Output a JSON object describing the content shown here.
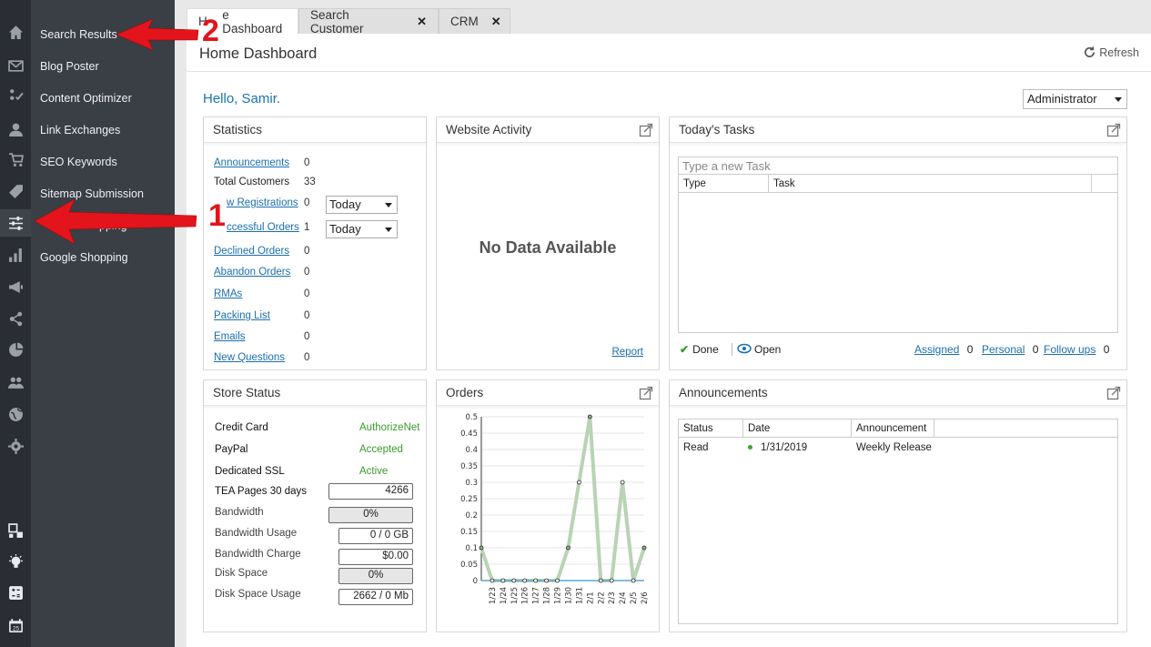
{
  "sidebar": {
    "rail_icons": [
      "home-icon",
      "mail-icon",
      "checklist-icon",
      "user-icon",
      "cart-icon",
      "tag-icon",
      "sliders-icon",
      "bar-chart-icon",
      "megaphone-icon",
      "share-icon",
      "pie-chart-icon",
      "users-group-icon",
      "globe-icon",
      "gear-icon",
      "layout-icon",
      "lightbulb-icon",
      "calculator-icon",
      "calendar-icon"
    ],
    "menu_items": [
      "Search Results",
      "Blog Poster",
      "Content Optimizer",
      "Link Exchanges",
      "SEO Keywords",
      "Sitemap Submission",
      "pping",
      "Google Shopping"
    ]
  },
  "tabs": [
    {
      "label": "H",
      "label2": "e Dashboard"
    },
    {
      "label": "Search Customer",
      "close": "✕"
    },
    {
      "label": "CRM",
      "close": "✕"
    }
  ],
  "header": {
    "title": "Home Dashboard",
    "refresh_label": "Refresh"
  },
  "greeting": "Hello, Samir.",
  "role": "Administrator",
  "statistics": {
    "title": "Statistics",
    "rows": [
      {
        "label": "Announcements",
        "value": "0",
        "link": true
      },
      {
        "label": "Total Customers",
        "value": "33",
        "link": false
      },
      {
        "label": "w Registrations",
        "value": "0",
        "link": true,
        "period": "Today"
      },
      {
        "label": "ccessful Orders",
        "value": "1",
        "link": true,
        "period": "Today"
      },
      {
        "label": "Declined Orders",
        "value": "0",
        "link": true
      },
      {
        "label": "Abandon Orders",
        "value": "0",
        "link": true
      },
      {
        "label": "RMAs",
        "value": "0",
        "link": true
      },
      {
        "label": "Packing List",
        "value": "0",
        "link": true
      },
      {
        "label": "Emails",
        "value": "0",
        "link": true
      },
      {
        "label": "New Questions",
        "value": "0",
        "link": true
      }
    ]
  },
  "website_activity": {
    "title": "Website Activity",
    "empty": "No Data Available",
    "report": "Report"
  },
  "tasks": {
    "title": "Today's Tasks",
    "placeholder": "Type a new Task",
    "columns": [
      "Type",
      "Task"
    ],
    "done": "Done",
    "open": "Open",
    "assigned": "Assigned",
    "assigned_count": "0",
    "personal": "Personal",
    "personal_count": "0",
    "followups": "Follow ups",
    "followups_count": "0"
  },
  "store_status": {
    "title": "Store Status",
    "credit_card": "Credit Card",
    "credit_card_value": "AuthorizeNet",
    "paypal": "PayPal",
    "paypal_value": "Accepted",
    "ssl": "Dedicated SSL",
    "ssl_value": "Active",
    "tea_pages": "TEA Pages 30 days",
    "tea_pages_value": "4266",
    "bandwidth": "Bandwidth",
    "bandwidth_value": "0%",
    "bandwidth_usage": "Bandwidth Usage",
    "bandwidth_usage_value": "0 / 0 GB",
    "bandwidth_charge": "Bandwidth Charge",
    "bandwidth_charge_value": "$0.00",
    "disk_space": "Disk Space",
    "disk_space_value": "0%",
    "disk_usage": "Disk Space Usage",
    "disk_usage_value": "2662 / 0 Mb"
  },
  "orders": {
    "title": "Orders"
  },
  "announcements": {
    "title": "Announcements",
    "columns": [
      "Status",
      "Date",
      "Announcement"
    ],
    "rows": [
      {
        "status": "Read",
        "date": "1/31/2019",
        "text": "Weekly Release"
      }
    ]
  },
  "annotations": {
    "callout_1": "1",
    "callout_2": "2"
  },
  "colors": {
    "link": "#1a6fb0",
    "accent_green": "#3a9a2a",
    "callout": "#e3141b",
    "series": "#b9d3b5"
  },
  "chart_data": {
    "type": "line",
    "title": "",
    "categories": [
      "1/23",
      "1/24",
      "1/25",
      "1/26",
      "1/27",
      "1/28",
      "1/29",
      "1/30",
      "1/31",
      "2/1",
      "2/2",
      "2/3",
      "2/4",
      "2/5",
      "2/6"
    ],
    "series": [
      {
        "values": [
          0.1,
          0,
          0,
          0,
          0,
          0,
          0,
          0,
          0.1,
          0.3,
          0.5,
          0,
          0,
          0.3,
          0,
          0.1
        ]
      }
    ],
    "x_points": [
      "1/23",
      "1/23b",
      "1/24",
      "1/25",
      "1/26",
      "1/27",
      "1/28",
      "1/29",
      "1/30",
      "1/31",
      "2/1",
      "2/2",
      "2/3",
      "2/4",
      "2/5",
      "2/6"
    ],
    "yticks": [
      "0",
      "0.05",
      "0.1",
      "0.15",
      "0.2",
      "0.25",
      "0.3",
      "0.35",
      "0.4",
      "0.45",
      "0.5"
    ],
    "ylim": [
      0,
      0.5
    ],
    "grid": true
  }
}
